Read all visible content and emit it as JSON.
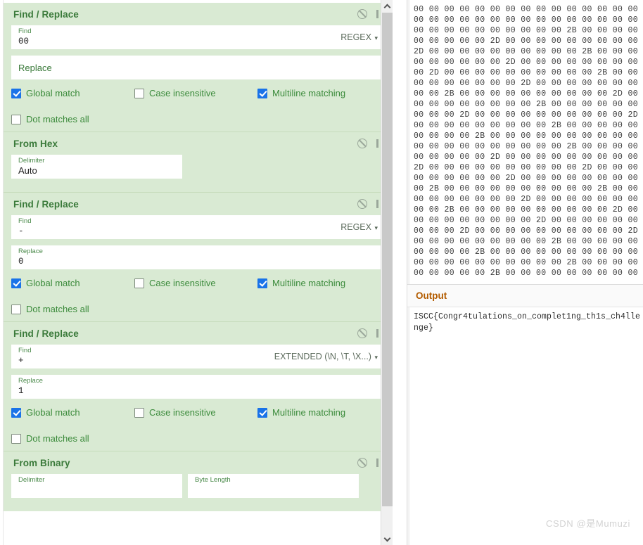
{
  "theme": {
    "operation_bg": "#d9ead3",
    "operation_border": "#c6dcbc",
    "title_color": "#3a7a3a",
    "label_color": "#4a8a4a",
    "checkbox_checked": "#1a73e8",
    "output_title_color": "#b35c00",
    "watermark_color": "#d2d2d2"
  },
  "recipe": {
    "operations": [
      {
        "name": "Find / Replace",
        "icons": {
          "disable": "ban-icon",
          "pause": "pause-icon"
        },
        "fields": [
          {
            "label": "Find",
            "value": "00",
            "mode": "REGEX",
            "has_mode": true
          },
          {
            "label": "Replace",
            "value": "",
            "placeholder": "Replace",
            "has_mode": false
          }
        ],
        "checkboxes": [
          {
            "label": "Global match",
            "checked": true
          },
          {
            "label": "Case insensitive",
            "checked": false
          },
          {
            "label": "Multiline matching",
            "checked": true
          },
          {
            "label": "Dot matches all",
            "checked": false
          }
        ]
      },
      {
        "name": "From Hex",
        "icons": {
          "disable": "ban-icon",
          "pause": "pause-icon"
        },
        "fields": [
          {
            "label": "Delimiter",
            "value": "Auto",
            "has_mode": false,
            "short": true
          }
        ],
        "checkboxes": []
      },
      {
        "name": "Find / Replace",
        "icons": {
          "disable": "ban-icon",
          "pause": "pause-icon"
        },
        "fields": [
          {
            "label": "Find",
            "value": "-",
            "mode": "REGEX",
            "has_mode": true
          },
          {
            "label": "Replace",
            "value": "0",
            "has_mode": false
          }
        ],
        "checkboxes": [
          {
            "label": "Global match",
            "checked": true
          },
          {
            "label": "Case insensitive",
            "checked": false
          },
          {
            "label": "Multiline matching",
            "checked": true
          },
          {
            "label": "Dot matches all",
            "checked": false
          }
        ]
      },
      {
        "name": "Find / Replace",
        "icons": {
          "disable": "ban-icon",
          "pause": "pause-icon"
        },
        "fields": [
          {
            "label": "Find",
            "value": "+",
            "mode": "EXTENDED (\\N, \\T, \\X...)",
            "has_mode": true
          },
          {
            "label": "Replace",
            "value": "1",
            "has_mode": false
          }
        ],
        "checkboxes": [
          {
            "label": "Global match",
            "checked": true
          },
          {
            "label": "Case insensitive",
            "checked": false
          },
          {
            "label": "Multiline matching",
            "checked": true
          },
          {
            "label": "Dot matches all",
            "checked": false
          }
        ]
      },
      {
        "name": "From Binary",
        "icons": {
          "disable": "ban-icon",
          "pause": "pause-icon"
        },
        "fields": [
          {
            "label": "Delimiter",
            "value": "",
            "has_mode": false,
            "short": true
          },
          {
            "label": "Byte Length",
            "value": "",
            "has_mode": false,
            "short": true
          }
        ],
        "checkboxes": []
      }
    ],
    "scrollbar": {
      "up_arrow": "chevron-up-icon",
      "down_arrow": "chevron-down-icon"
    }
  },
  "input": {
    "hex_lines": [
      "00 00 00 00 00 00 00 00 00 00 00 00 00 00 00 00",
      "00 00 00 00 00 00 00 00 00 00 00 00 00 00 00 2D",
      "00 00 00 00 00 00 00 00 00 00 2B 00 00 00 00 00",
      "00 00 00 00 00 2D 00 00 00 00 00 00 00 00 00 00",
      "2D 00 00 00 00 00 00 00 00 00 00 2B 00 00 00 00",
      "00 00 00 00 00 00 2D 00 00 00 00 00 00 00 00 00",
      "00 2D 00 00 00 00 00 00 00 00 00 00 2B 00 00 00",
      "00 00 00 00 00 00 00 2D 00 00 00 00 00 00 00 00",
      "00 00 2B 00 00 00 00 00 00 00 00 00 00 2D 00 00",
      "00 00 00 00 00 00 00 00 2B 00 00 00 00 00 00 00",
      "00 00 00 2D 00 00 00 00 00 00 00 00 00 00 2D 00",
      "00 00 00 00 00 00 00 00 00 2B 00 00 00 00 00 00",
      "00 00 00 00 2B 00 00 00 00 00 00 00 00 00 00 2D",
      "00 00 00 00 00 00 00 00 00 00 2B 00 00 00 00 00",
      "00 00 00 00 00 2D 00 00 00 00 00 00 00 00 00 00",
      "2D 00 00 00 00 00 00 00 00 00 00 2D 00 00 00 00",
      "00 00 00 00 00 00 2D 00 00 00 00 00 00 00 00 00",
      "00 2B 00 00 00 00 00 00 00 00 00 00 2B 00 00 00",
      "00 00 00 00 00 00 00 2D 00 00 00 00 00 00 00 00",
      "00 00 2B 00 00 00 00 00 00 00 00 00 00 2D 00 00",
      "00 00 00 00 00 00 00 00 2D 00 00 00 00 00 00 00",
      "00 00 00 2D 00 00 00 00 00 00 00 00 00 00 2D 00",
      "00 00 00 00 00 00 00 00 00 2B 00 00 00 00 00 00",
      "00 00 00 00 2B 00 00 00 00 00 00 00 00 00 00 2D",
      "00 00 00 00 00 00 00 00 00 00 2B 00 00 00 00 00",
      "00 00 00 00 00 2B 00 00 00 00 00 00 00 00 00 00"
    ]
  },
  "output": {
    "title": "Output",
    "text": "ISCC{Congr4tulations_on_complet1ng_th1s_ch4llenge}"
  },
  "watermark": {
    "text": "CSDN @是Mumuzi"
  }
}
